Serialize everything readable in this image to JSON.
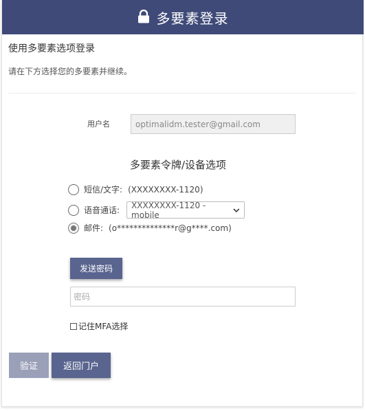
{
  "header": {
    "title": "多要素登录",
    "icon": "lock-icon",
    "background": "#3f4a78"
  },
  "subtitle": "使用多要素选项登录",
  "instructions": "请在下方选择您的多要素并继续。",
  "username": {
    "label": "用户名",
    "value": "optimalidm.tester@gmail.com"
  },
  "mfa": {
    "title": "多要素令牌/设备选项",
    "options": [
      {
        "label": "短信/文字:",
        "detail": "(XXXXXXXX-1120)",
        "selected": false
      },
      {
        "label": "语音通话:",
        "select_value": "XXXXXXXX-1120 - mobile",
        "selected": false
      },
      {
        "label": "邮件:",
        "detail": "(o**************r@g****.com)",
        "selected": true
      }
    ]
  },
  "send_code_button": "发送密码",
  "password": {
    "placeholder": "密码",
    "value": ""
  },
  "remember": {
    "label": "记住MFA选择",
    "checked": false
  },
  "buttons": {
    "verify": "验证",
    "back": "返回门户"
  },
  "colors": {
    "primary": "#59648f",
    "disabled": "#9aa0b8"
  }
}
